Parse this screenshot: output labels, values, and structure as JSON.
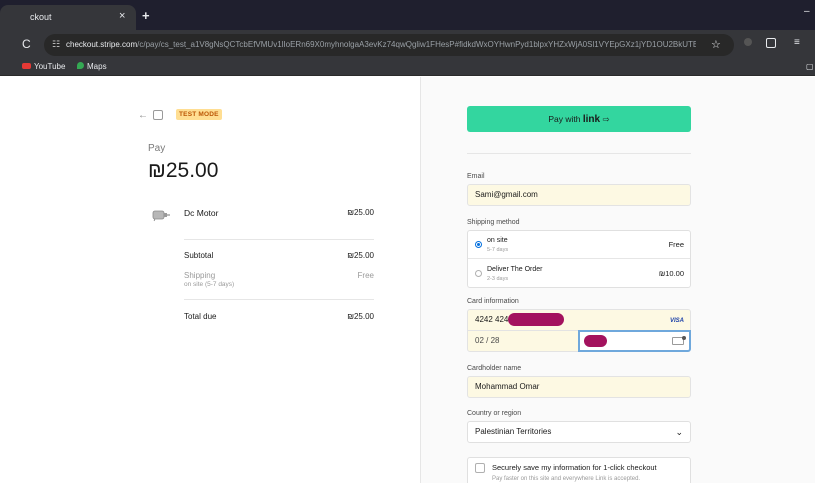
{
  "browser": {
    "tab_title": "ckout",
    "tab_close": "×",
    "new_tab": "+",
    "window_min": "–",
    "url_host": "checkout.stripe.com",
    "url_path": "/c/pay/cs_test_a1V8gNsQCTcbEfVMUv1lIoERn69X0myhnolgaA3evKz74qwQgliw1FHesP#fidkdWxOYHwnPyd1blpxYHZxWjA0Sl1VYEpGXz1jYD1OU2BkUTB0QE...",
    "bookmarks": [
      "YouTube",
      "Maps"
    ],
    "icons": [
      "reload-icon",
      "site-info-icon",
      "star-icon",
      "extension-icon",
      "side-panel-icon"
    ]
  },
  "summary": {
    "badge": "TEST MODE",
    "pay_label": "Pay",
    "amount": "₪25.00",
    "item_name": "Dc Motor",
    "item_price": "₪25.00",
    "subtotal_label": "Subtotal",
    "subtotal_value": "₪25.00",
    "shipping_label": "Shipping",
    "shipping_sub": "on site (5-7 days)",
    "shipping_value": "Free",
    "total_label": "Total due",
    "total_value": "₪25.00"
  },
  "checkout": {
    "link_button_prefix": "Pay with",
    "link_button_brand": "link",
    "link_button_arrow": "⇨",
    "email_label": "Email",
    "email_value": "Sami@gmail.com",
    "shipping_method_label": "Shipping method",
    "shipping_options": [
      {
        "name": "on site",
        "days": "5-7 days",
        "price": "Free",
        "selected": true
      },
      {
        "name": "Deliver The Order",
        "days": "2-3 days",
        "price": "₪10.00",
        "selected": false
      }
    ],
    "card_label": "Card information",
    "card_number_visible": "4242 424",
    "card_brand": "VISA",
    "card_expiry": "02 / 28",
    "cardholder_label": "Cardholder name",
    "cardholder_value": "Mohammad Omar",
    "country_label": "Country or region",
    "country_value": "Palestinian Territories",
    "chevron": "⌄",
    "save_title": "Securely save my information for 1-click checkout",
    "save_sub": "Pay faster on this site and everywhere Link is accepted."
  },
  "colors": {
    "link_green": "#33d69f",
    "test_badge_bg": "#ffde92",
    "test_badge_text": "#bb5504",
    "autofill_yellow": "#fdf9e3",
    "redaction": "#a3125e",
    "focus_blue": "#6fa8dc"
  }
}
